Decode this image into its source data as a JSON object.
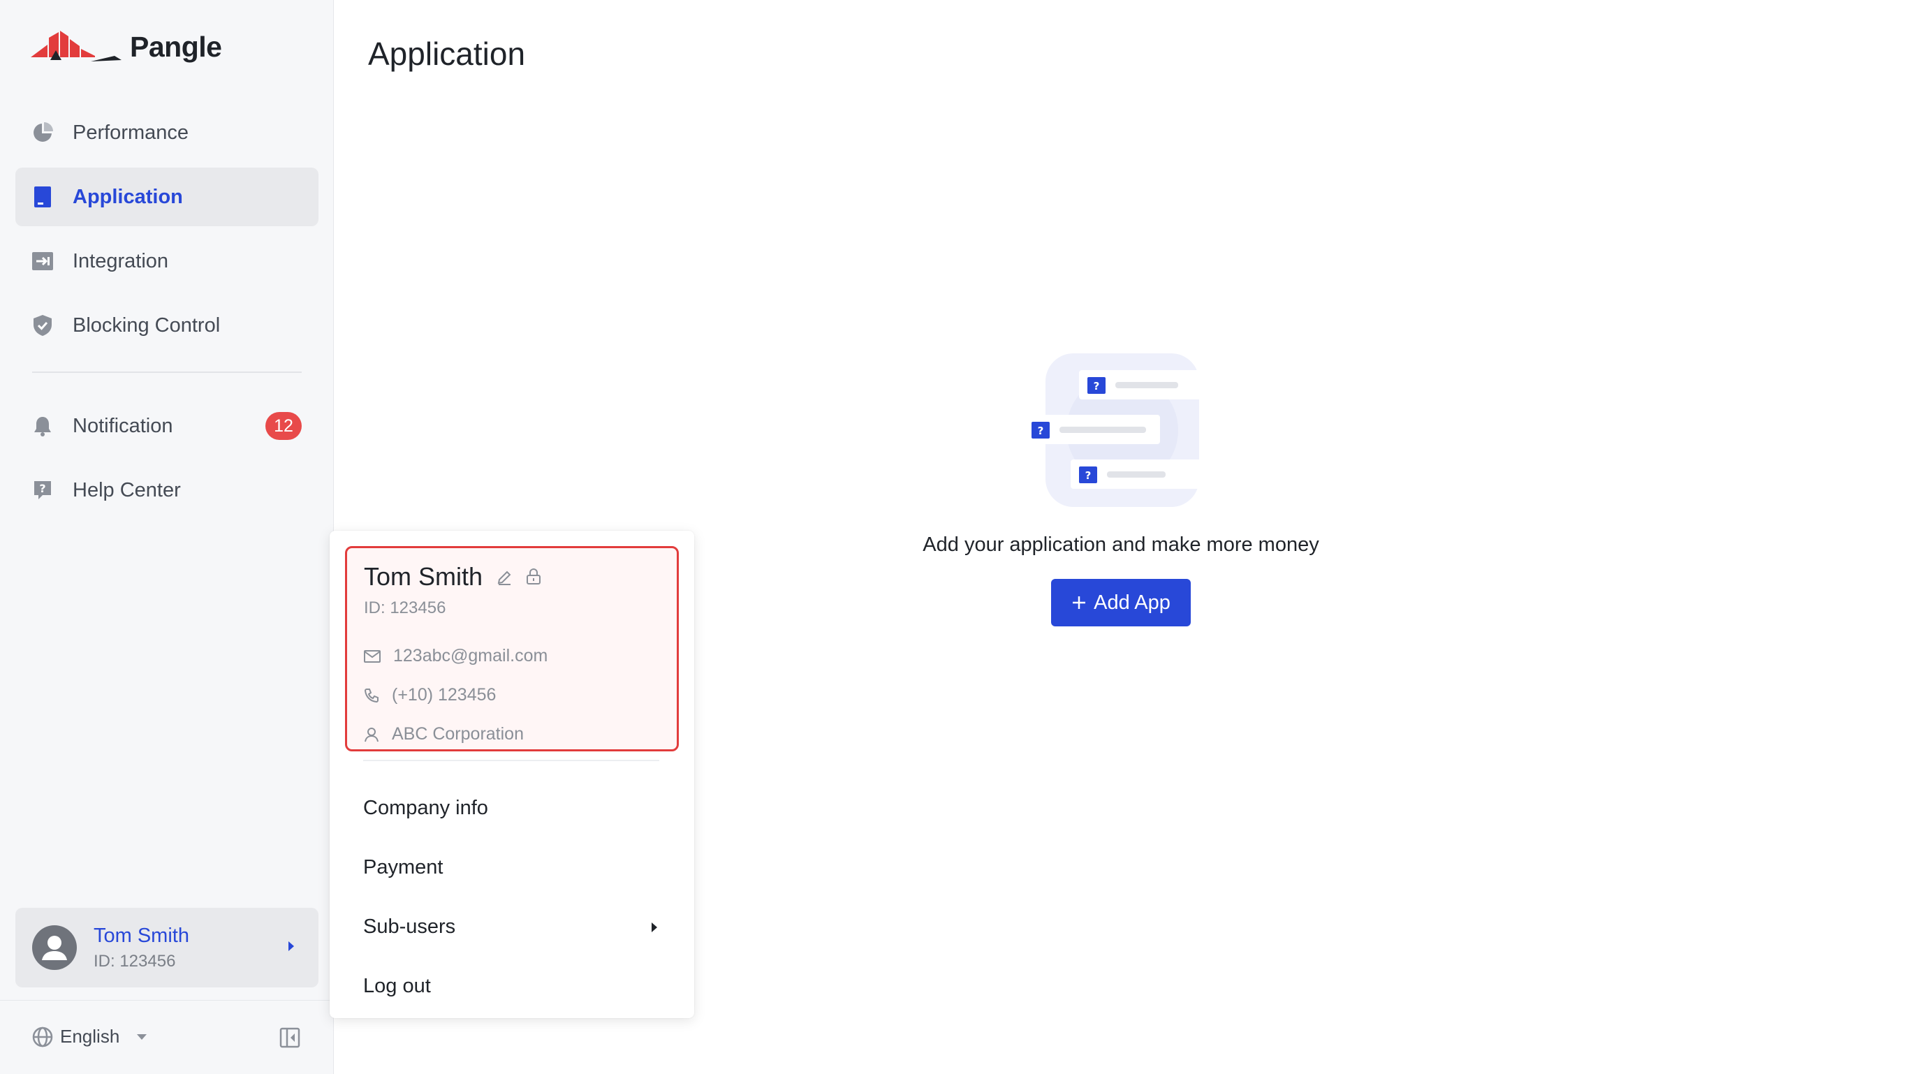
{
  "brand": {
    "name": "Pangle",
    "accent": "#2848d8",
    "logo_red": "#e23c3c"
  },
  "sidebar": {
    "items": [
      {
        "label": "Performance",
        "icon": "pie-chart-icon"
      },
      {
        "label": "Application",
        "icon": "app-icon",
        "active": true
      },
      {
        "label": "Integration",
        "icon": "integration-icon"
      },
      {
        "label": "Blocking Control",
        "icon": "shield-icon"
      }
    ],
    "secondary_items": [
      {
        "label": "Notification",
        "icon": "bell-icon",
        "badge": "12"
      },
      {
        "label": "Help Center",
        "icon": "help-icon"
      }
    ],
    "user": {
      "name": "Tom Smith",
      "id": "ID: 123456"
    },
    "language": "English"
  },
  "main": {
    "title": "Application",
    "empty_state": {
      "message": "Add your application and make more money",
      "button_label": "Add App"
    }
  },
  "profile_menu": {
    "name": "Tom Smith",
    "id": "ID: 123456",
    "email": "123abc@gmail.com",
    "phone": "(+10) 123456",
    "company": "ABC Corporation",
    "items": [
      "Company info",
      "Payment",
      "Sub-users",
      "Log out"
    ]
  }
}
